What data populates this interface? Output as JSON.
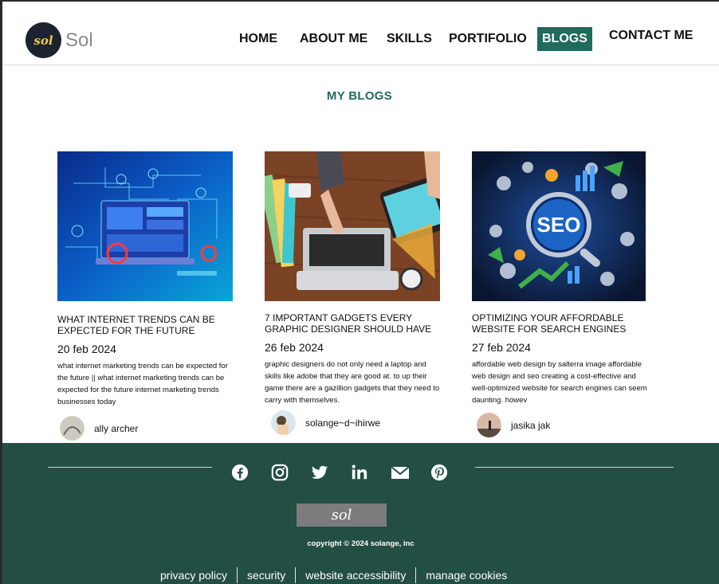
{
  "brand": {
    "name": "Sol",
    "logo_text": "sol"
  },
  "nav": {
    "items": [
      {
        "label": "HOME"
      },
      {
        "label": "ABOUT ME"
      },
      {
        "label": "SKILLS"
      },
      {
        "label": "PORTIFOLIO"
      },
      {
        "label": "BLOGS",
        "active": true
      },
      {
        "label": "CONTACT ME"
      }
    ]
  },
  "page_title": "MY BLOGS",
  "posts": [
    {
      "title": "WHAT INTERNET  TRENDS CAN BE EXPECTED FOR THE FUTURE",
      "date": "20 feb 2024",
      "excerpt": "what internet marketing trends can be expected for the future || what internet marketing trends can be expected for the future internet marketing trends businesses today",
      "author": "ally archer"
    },
    {
      "title": "7 IMPORTANT GADGETS EVERY GRAPHIC DESIGNER SHOULD HAVE",
      "date": "26 feb 2024",
      "excerpt": "graphic designers do not only need a laptop and skills like adobe that they are good at. to up their game there are a gazillion gadgets that they need to carry with themselves.",
      "author": "solange~d~ihirwe"
    },
    {
      "title": "OPTIMIZING YOUR AFFORDABLE WEBSITE FOR SEARCH ENGINES",
      "date": "27 feb 2024",
      "excerpt": "affordable web design by salterra image affordable web design and seo creating a cost-effective and well-optimized website for search engines can seem daunting. howev",
      "author": "jasika jak",
      "image_text": "SEO"
    }
  ],
  "footer": {
    "social_icons": [
      "facebook-icon",
      "instagram-icon",
      "twitter-icon",
      "linkedin-icon",
      "mail-icon",
      "pinterest-icon"
    ],
    "logo_text": "sol",
    "copyright": "copyright © 2024 solange, inc",
    "links": [
      "privacy policy",
      "security",
      "website accessibility",
      "manage cookies"
    ]
  },
  "colors": {
    "accent": "#1f6b5c",
    "footer_bg": "#234e43"
  }
}
